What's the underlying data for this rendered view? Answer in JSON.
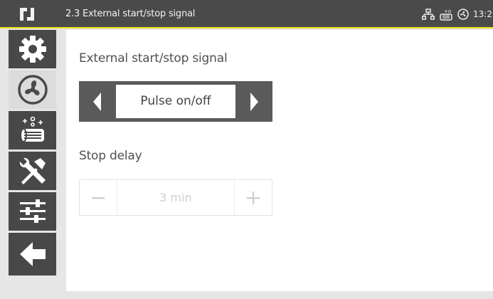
{
  "header": {
    "title": "2.3 External start/stop signal",
    "time": "13:2"
  },
  "sidebar": {
    "items": [
      {
        "icon": "gear-icon"
      },
      {
        "icon": "fan-icon",
        "active": true
      },
      {
        "icon": "filter-icon"
      },
      {
        "icon": "tools-icon"
      },
      {
        "icon": "sliders-icon"
      },
      {
        "icon": "back-arrow-icon"
      }
    ]
  },
  "main": {
    "signal_label": "External start/stop signal",
    "signal_value": "Pulse on/off",
    "delay_label": "Stop delay",
    "delay_value": "3 min"
  },
  "colors": {
    "header_bg": "#4a4a4a",
    "accent": "#f2dd1c",
    "sidebar_bg": "#484848"
  }
}
